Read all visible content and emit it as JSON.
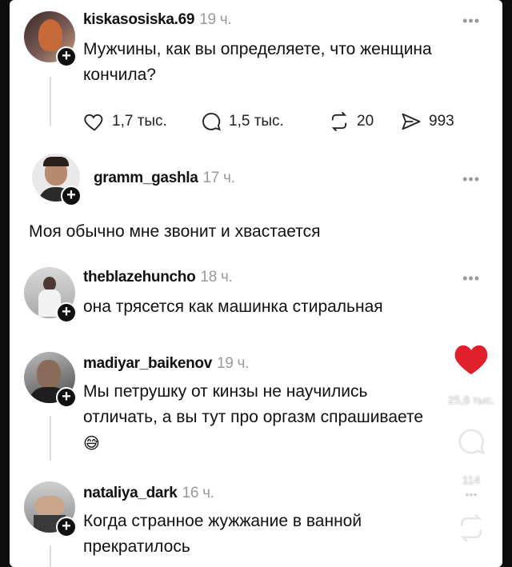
{
  "posts": [
    {
      "username": "kiskasosiska.69",
      "time": "19 ч.",
      "text_line1": "Мужчины, как вы определяете, что женщина",
      "text_line2": "кончила?",
      "actions": {
        "likes": "1,7 тыс.",
        "comments": "1,5 тыс.",
        "reposts": "20",
        "shares": "993"
      }
    },
    {
      "username": "gramm_gashla",
      "time": "17 ч.",
      "text": "Моя обычно мне звонит и хвастается"
    },
    {
      "username": "theblazehuncho",
      "time": "18 ч.",
      "text": "она трясется как машинка стиральная"
    },
    {
      "username": "madiyar_baikenov",
      "time": "19 ч.",
      "text_line1": "Мы петрушку от кинзы не научились",
      "text_line2": "отличать, а вы тут про оргазм спрашиваете",
      "emoji": "😅"
    },
    {
      "username": "nataliya_dark",
      "time": "16 ч.",
      "text_line1": "Когда странное жужжание в ванной",
      "text_line2": "прекратилось"
    }
  ],
  "more_label": "•••",
  "plus_label": "+",
  "sidebar": {
    "like_count": "25,8 тыс.",
    "comment_count": "114"
  },
  "colors": {
    "accent_like": "#e0202a",
    "muted": "#9a9a9a",
    "thread": "#dcdcdc"
  },
  "icons": [
    "heart-icon",
    "comment-icon",
    "repost-icon",
    "send-icon",
    "plus-icon",
    "more-icon"
  ]
}
